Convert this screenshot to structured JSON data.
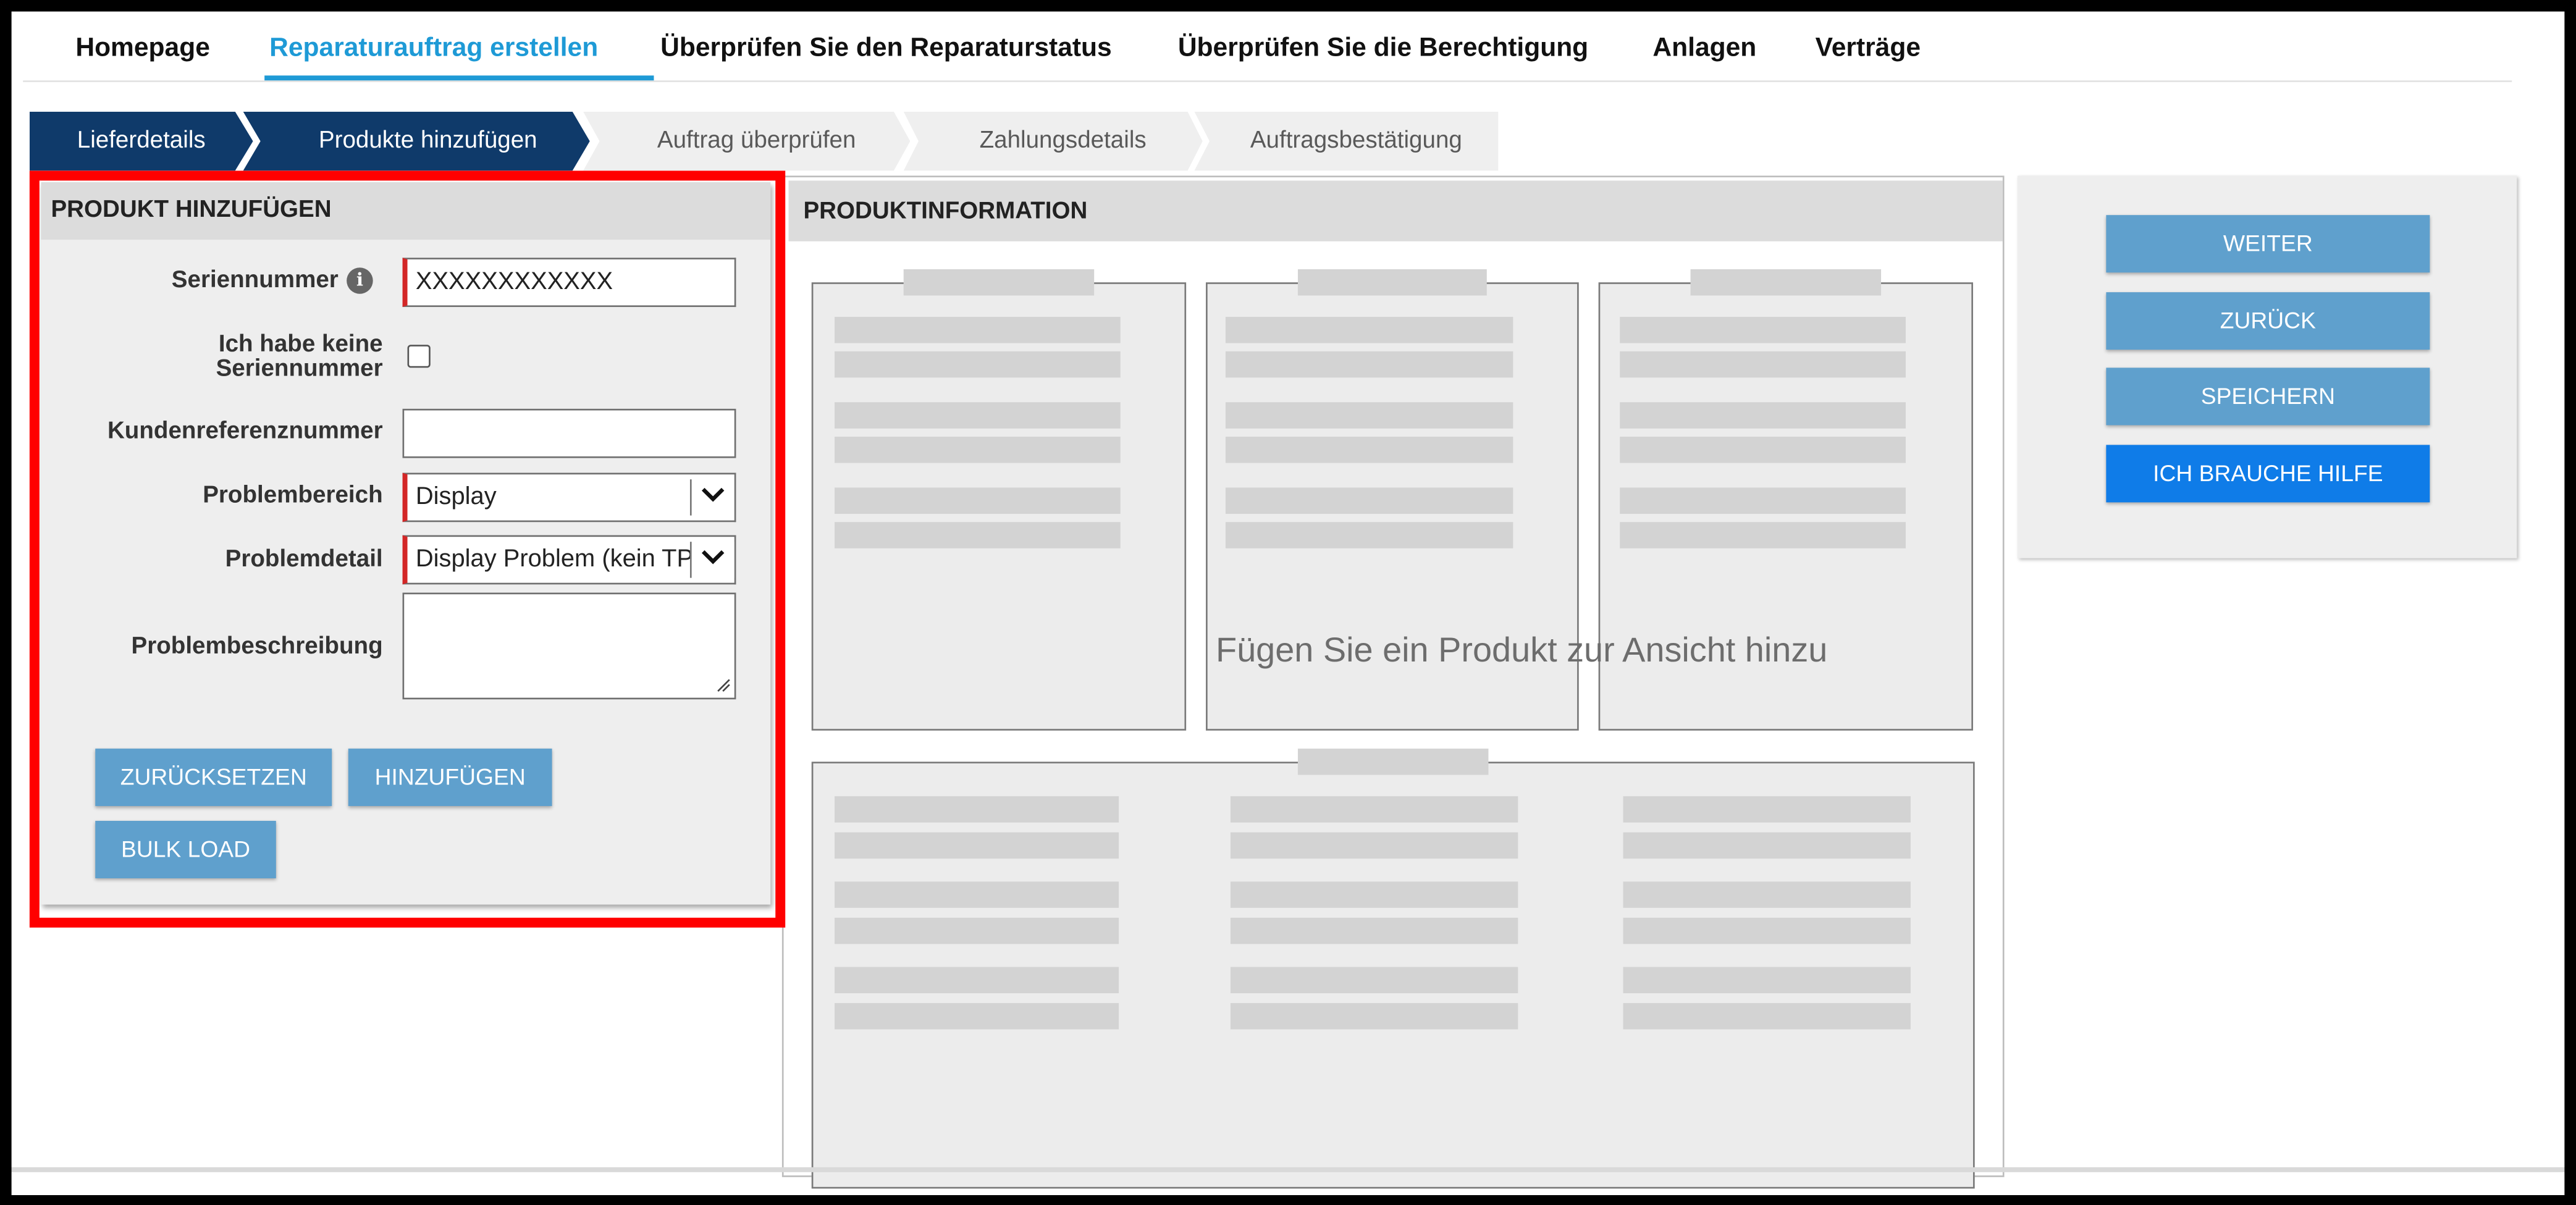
{
  "nav": {
    "tabs": [
      "Homepage",
      "Reparaturauftrag erstellen",
      "Überprüfen Sie den Reparaturstatus",
      "Überprüfen Sie die Berechtigung",
      "Anlagen",
      "Verträge"
    ],
    "active_tab": "Reparaturauftrag erstellen"
  },
  "steps": [
    "Lieferdetails",
    "Produkte hinzufügen",
    "Auftrag überprüfen",
    "Zahlungsdetails",
    "Auftragsbestätigung"
  ],
  "add_panel": {
    "title": "PRODUKT HINZUFÜGEN",
    "serial_label": "Seriennummer",
    "serial_value": "XXXXXXXXXXXX",
    "no_serial_label_line1": "Ich habe keine",
    "no_serial_label_line2": "Seriennummer",
    "customer_ref_label": "Kundenreferenznummer",
    "customer_ref_value": "",
    "problem_area_label": "Problembereich",
    "problem_area_value": "Display",
    "problem_detail_label": "Problemdetail",
    "problem_detail_value": "Display Problem (kein TP",
    "problem_desc_label": "Problembeschreibung",
    "problem_desc_value": "",
    "reset_label": "ZURÜCKSETZEN",
    "add_label": "HINZUFÜGEN",
    "bulk_label": "BULK LOAD"
  },
  "product_info": {
    "title": "PRODUKTINFORMATION",
    "empty_message": "Fügen Sie ein Produkt zur Ansicht hinzu"
  },
  "actions": {
    "next": "WEITER",
    "back": "ZURÜCK",
    "save": "SPEICHERN",
    "help": "ICH BRAUCHE HILFE"
  },
  "colors": {
    "accent": "#1e9ad6",
    "step_done": "#0f3a6a",
    "button": "#5fa0cd",
    "help_button": "#0f7ce8",
    "highlight": "#ff0000",
    "required": "#d32626"
  }
}
